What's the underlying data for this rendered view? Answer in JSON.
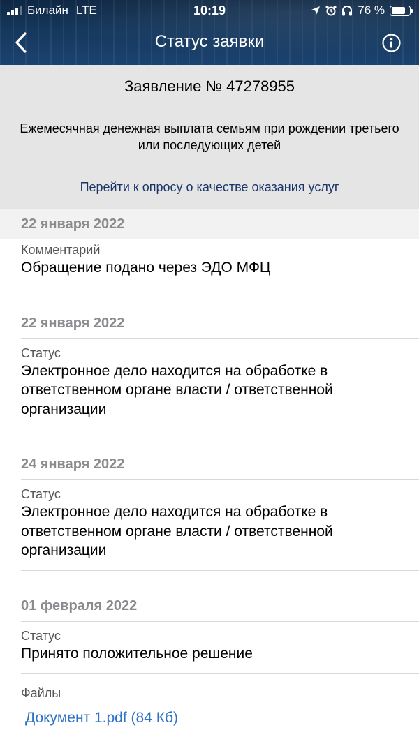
{
  "status_bar": {
    "carrier": "Билайн",
    "network": "LTE",
    "time": "10:19",
    "battery": "76 %",
    "battery_level": 0.76
  },
  "nav": {
    "title": "Статус заявки",
    "back_icon": "chevron-left-icon",
    "info_icon": "info-circle-icon"
  },
  "summary": {
    "application_number": "Заявление № 47278955",
    "service_name": "Ежемесячная денежная выплата семьям при рождении третьего или последующих детей",
    "survey_link": "Перейти к опросу о качестве оказания услуг"
  },
  "history": [
    {
      "date": "22 января 2022",
      "entries": [
        {
          "label": "Комментарий",
          "value": "Обращение подано через ЭДО МФЦ"
        }
      ]
    },
    {
      "date": "22 января 2022",
      "entries": [
        {
          "label": "Статус",
          "value": "Электронное дело находится на обработке в ответственном органе власти / ответственной организации"
        }
      ]
    },
    {
      "date": "24 января 2022",
      "entries": [
        {
          "label": "Статус",
          "value": "Электронное дело находится на обработке в ответственном органе власти / ответственной организации"
        }
      ]
    },
    {
      "date": "01 февраля 2022",
      "entries": [
        {
          "label": "Статус",
          "value": "Принято положительное решение"
        },
        {
          "label": "Файлы",
          "link": "Документ 1.pdf (84 Кб)"
        }
      ]
    }
  ],
  "colors": {
    "header_bg": "#15375c",
    "summary_bg": "#e5e5e5",
    "survey_link": "#1a3468",
    "file_link": "#2e72c7",
    "date_text": "#8a8a8f"
  }
}
